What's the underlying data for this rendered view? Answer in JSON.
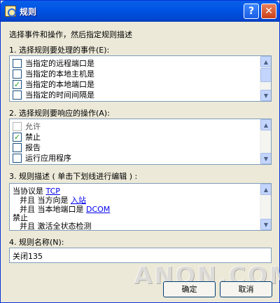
{
  "window": {
    "title": "规则",
    "help_glyph": "?",
    "close_glyph": "✕"
  },
  "instruction": "选择事件和操作，然后指定规则描述",
  "events": {
    "label": "1. 选择规则要处理的事件(E):",
    "items": [
      {
        "label": "当指定的远程端口是",
        "checked": false
      },
      {
        "label": "当指定的本地主机是",
        "checked": false
      },
      {
        "label": "当指定的本地端口是",
        "checked": true
      },
      {
        "label": "当指定的时间间隔是",
        "checked": false
      }
    ]
  },
  "actions": {
    "label": "2. 选择规则要响应的操作(A):",
    "items": [
      {
        "label": "允许",
        "checked": false,
        "disabled": true
      },
      {
        "label": "禁止",
        "checked": true
      },
      {
        "label": "报告",
        "checked": false
      },
      {
        "label": "运行应用程序",
        "checked": false
      }
    ]
  },
  "description": {
    "label": "3. 规则描述 ( 单击下划线进行编辑 ) :",
    "line1": {
      "text": "当协议是",
      "link": "TCP"
    },
    "line2": {
      "text": "并且 当方向是",
      "link": "入站"
    },
    "line3": {
      "text": "并且 当本地端口是",
      "link": "DCOM"
    },
    "line4": {
      "text": "禁止"
    },
    "line5": {
      "text": "并且 激活全状态检测"
    }
  },
  "name": {
    "label": "4. 规则名称(N):",
    "value": "关闭135"
  },
  "buttons": {
    "ok": "确定",
    "cancel": "取消"
  },
  "watermark": "ANQN.COM",
  "check_glyph": "✓",
  "scroll": {
    "up": "▲",
    "down": "▼"
  }
}
